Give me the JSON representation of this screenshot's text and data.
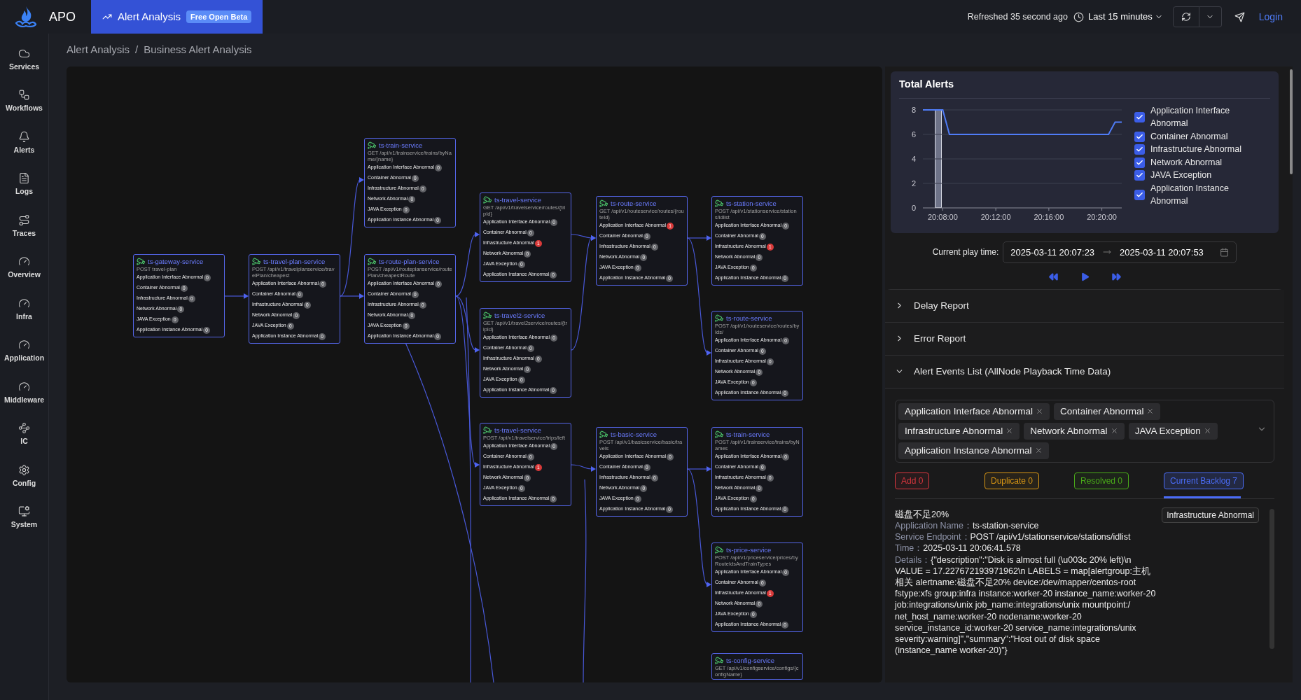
{
  "top_bar": {
    "app_name": "APO",
    "active_tab": {
      "label": "Alert Analysis",
      "badge": "Free Open Beta"
    },
    "refreshed": "Refreshed 35 second ago",
    "time_range": "Last 15 minutes",
    "login": "Login"
  },
  "sidebar": {
    "items": [
      {
        "label": "Services"
      },
      {
        "label": "Workflows"
      },
      {
        "label": "Alerts"
      },
      {
        "label": "Logs"
      },
      {
        "label": "Traces"
      },
      {
        "label": "Overview"
      },
      {
        "label": "Infra"
      },
      {
        "label": "Application"
      },
      {
        "label": "Middleware"
      },
      {
        "label": "IC"
      },
      {
        "label": "Config"
      },
      {
        "label": "System"
      }
    ]
  },
  "breadcrumb": {
    "items": [
      "Alert Analysis",
      "Business Alert Analysis"
    ],
    "separator": "/"
  },
  "graph": {
    "nodes": [
      {
        "name": "ts-gateway-service",
        "endpoint": "POST travel-plan",
        "rows": [
          {
            "label": "Application Interface Abnormal",
            "count": "0",
            "alert": false
          },
          {
            "label": "Container Abnormal",
            "count": "0",
            "alert": false
          },
          {
            "label": "Infrastructure Abnormal",
            "count": "0",
            "alert": false
          },
          {
            "label": "Network Abnormal",
            "count": "0",
            "alert": false
          },
          {
            "label": "JAVA Exception",
            "count": "0",
            "alert": false
          },
          {
            "label": "Application Instance Abnormal",
            "count": "0",
            "alert": false
          }
        ]
      },
      {
        "name": "ts-travel-plan-service",
        "endpoint": "POST /api/v1/travelplanservice/travelPlan/cheapest",
        "rows": [
          {
            "label": "Application Interface Abnormal",
            "count": "0",
            "alert": false
          },
          {
            "label": "Container Abnormal",
            "count": "0",
            "alert": false
          },
          {
            "label": "Infrastructure Abnormal",
            "count": "0",
            "alert": false
          },
          {
            "label": "Network Abnormal",
            "count": "0",
            "alert": false
          },
          {
            "label": "JAVA Exception",
            "count": "0",
            "alert": false
          },
          {
            "label": "Application Instance Abnormal",
            "count": "0",
            "alert": false
          }
        ]
      },
      {
        "name": "ts-train-service",
        "endpoint": "GET /api/v1/trainservice/trains/byName/{name}",
        "rows": [
          {
            "label": "Application Interface Abnormal",
            "count": "0",
            "alert": false
          },
          {
            "label": "Container Abnormal",
            "count": "0",
            "alert": false
          },
          {
            "label": "Infrastructure Abnormal",
            "count": "0",
            "alert": false
          },
          {
            "label": "Network Abnormal",
            "count": "0",
            "alert": false
          },
          {
            "label": "JAVA Exception",
            "count": "0",
            "alert": false
          },
          {
            "label": "Application Instance Abnormal",
            "count": "0",
            "alert": false
          }
        ]
      },
      {
        "name": "ts-route-plan-service",
        "endpoint": "POST /api/v1/routeplanservice/routePlan/cheapestRoute",
        "rows": [
          {
            "label": "Application Interface Abnormal",
            "count": "0",
            "alert": false
          },
          {
            "label": "Container Abnormal",
            "count": "0",
            "alert": false
          },
          {
            "label": "Infrastructure Abnormal",
            "count": "0",
            "alert": false
          },
          {
            "label": "Network Abnormal",
            "count": "0",
            "alert": false
          },
          {
            "label": "JAVA Exception",
            "count": "0",
            "alert": false
          },
          {
            "label": "Application Instance Abnormal",
            "count": "0",
            "alert": false
          }
        ]
      },
      {
        "name": "ts-travel-service",
        "endpoint": "GET /api/v1/travelservice/routes/{tripId}",
        "rows": [
          {
            "label": "Application Interface Abnormal",
            "count": "0",
            "alert": false
          },
          {
            "label": "Container Abnormal",
            "count": "0",
            "alert": false
          },
          {
            "label": "Infrastructure Abnormal",
            "count": "1",
            "alert": true
          },
          {
            "label": "Network Abnormal",
            "count": "0",
            "alert": false
          },
          {
            "label": "JAVA Exception",
            "count": "0",
            "alert": false
          },
          {
            "label": "Application Instance Abnormal",
            "count": "0",
            "alert": false
          }
        ]
      },
      {
        "name": "ts-travel2-service",
        "endpoint": "GET /api/v1/travel2service/routes/{tripId}",
        "rows": [
          {
            "label": "Application Interface Abnormal",
            "count": "0",
            "alert": false
          },
          {
            "label": "Container Abnormal",
            "count": "0",
            "alert": false
          },
          {
            "label": "Infrastructure Abnormal",
            "count": "0",
            "alert": false
          },
          {
            "label": "Network Abnormal",
            "count": "0",
            "alert": false
          },
          {
            "label": "JAVA Exception",
            "count": "0",
            "alert": false
          },
          {
            "label": "Application Instance Abnormal",
            "count": "0",
            "alert": false
          }
        ]
      },
      {
        "name": "ts-travel-service",
        "endpoint": "POST /api/v1/travelservice/trips/left",
        "rows": [
          {
            "label": "Application Interface Abnormal",
            "count": "0",
            "alert": false
          },
          {
            "label": "Container Abnormal",
            "count": "0",
            "alert": false
          },
          {
            "label": "Infrastructure Abnormal",
            "count": "1",
            "alert": true
          },
          {
            "label": "Network Abnormal",
            "count": "0",
            "alert": false
          },
          {
            "label": "JAVA Exception",
            "count": "0",
            "alert": false
          },
          {
            "label": "Application Instance Abnormal",
            "count": "0",
            "alert": false
          }
        ]
      },
      {
        "name": "ts-route-service",
        "endpoint": "GET /api/v1/routeservice/routes/{routeId}",
        "rows": [
          {
            "label": "Application Interface Abnormal",
            "count": "1",
            "alert": true
          },
          {
            "label": "Container Abnormal",
            "count": "0",
            "alert": false
          },
          {
            "label": "Infrastructure Abnormal",
            "count": "0",
            "alert": false
          },
          {
            "label": "Network Abnormal",
            "count": "0",
            "alert": false
          },
          {
            "label": "JAVA Exception",
            "count": "0",
            "alert": false
          },
          {
            "label": "Application Instance Abnormal",
            "count": "0",
            "alert": false
          }
        ]
      },
      {
        "name": "ts-basic-service",
        "endpoint": "POST /api/v1/basicservice/basic/travels",
        "rows": [
          {
            "label": "Application Interface Abnormal",
            "count": "0",
            "alert": false
          },
          {
            "label": "Container Abnormal",
            "count": "0",
            "alert": false
          },
          {
            "label": "Infrastructure Abnormal",
            "count": "0",
            "alert": false
          },
          {
            "label": "Network Abnormal",
            "count": "0",
            "alert": false
          },
          {
            "label": "JAVA Exception",
            "count": "0",
            "alert": false
          },
          {
            "label": "Application Instance Abnormal",
            "count": "0",
            "alert": false
          }
        ]
      },
      {
        "name": "ts-station-service",
        "endpoint": "POST /api/v1/stationservice/stations/idlist",
        "rows": [
          {
            "label": "Application Interface Abnormal",
            "count": "0",
            "alert": false
          },
          {
            "label": "Container Abnormal",
            "count": "0",
            "alert": false
          },
          {
            "label": "Infrastructure Abnormal",
            "count": "1",
            "alert": true
          },
          {
            "label": "Network Abnormal",
            "count": "0",
            "alert": false
          },
          {
            "label": "JAVA Exception",
            "count": "0",
            "alert": false
          },
          {
            "label": "Application Instance Abnormal",
            "count": "0",
            "alert": false
          }
        ]
      },
      {
        "name": "ts-route-service",
        "endpoint": "POST /api/v1/routeservice/routes/byIds/",
        "rows": [
          {
            "label": "Application Interface Abnormal",
            "count": "0",
            "alert": false
          },
          {
            "label": "Container Abnormal",
            "count": "0",
            "alert": false
          },
          {
            "label": "Infrastructure Abnormal",
            "count": "0",
            "alert": false
          },
          {
            "label": "Network Abnormal",
            "count": "0",
            "alert": false
          },
          {
            "label": "JAVA Exception",
            "count": "0",
            "alert": false
          },
          {
            "label": "Application Instance Abnormal",
            "count": "0",
            "alert": false
          }
        ]
      },
      {
        "name": "ts-train-service",
        "endpoint": "POST /api/v1/trainservice/trains/byNames",
        "rows": [
          {
            "label": "Application Interface Abnormal",
            "count": "0",
            "alert": false
          },
          {
            "label": "Container Abnormal",
            "count": "0",
            "alert": false
          },
          {
            "label": "Infrastructure Abnormal",
            "count": "0",
            "alert": false
          },
          {
            "label": "Network Abnormal",
            "count": "0",
            "alert": false
          },
          {
            "label": "JAVA Exception",
            "count": "0",
            "alert": false
          },
          {
            "label": "Application Instance Abnormal",
            "count": "0",
            "alert": false
          }
        ]
      },
      {
        "name": "ts-price-service",
        "endpoint": "POST /api/v1/priceservice/prices/byRouteIdsAndTrainTypes",
        "rows": [
          {
            "label": "Application Interface Abnormal",
            "count": "0",
            "alert": false
          },
          {
            "label": "Container Abnormal",
            "count": "0",
            "alert": false
          },
          {
            "label": "Infrastructure Abnormal",
            "count": "1",
            "alert": true
          },
          {
            "label": "Network Abnormal",
            "count": "0",
            "alert": false
          },
          {
            "label": "JAVA Exception",
            "count": "0",
            "alert": false
          },
          {
            "label": "Application Instance Abnormal",
            "count": "0",
            "alert": false
          }
        ]
      },
      {
        "name": "ts-config-service",
        "endpoint": "GET /api/v1/configservice/configs/{configName}"
      }
    ]
  },
  "total_alerts": {
    "chart_data": {
      "type": "line",
      "title": "Total Alerts",
      "categories": [
        null,
        null,
        null,
        "20:08:00",
        null,
        null,
        null,
        null,
        null,
        null,
        null,
        "20:12:00",
        null,
        null,
        null,
        null,
        null,
        null,
        null,
        "20:16:00",
        null,
        null,
        null,
        null,
        null,
        null,
        null,
        "20:20:00",
        null,
        null,
        null
      ],
      "values": [
        8,
        8,
        8,
        8,
        6,
        6,
        6,
        6,
        6,
        6,
        6,
        6,
        6,
        6,
        6,
        6,
        6,
        6,
        6,
        6,
        6,
        6,
        6,
        6,
        6,
        6,
        6,
        6,
        6,
        7,
        7
      ],
      "ylim": [
        0,
        8
      ],
      "yticks": [
        0,
        2,
        4,
        6,
        8
      ],
      "grid": true
    },
    "legend": [
      {
        "label": "Application Interface Abnormal",
        "checked": true
      },
      {
        "label": "Container Abnormal",
        "checked": true
      },
      {
        "label": "Infrastructure Abnormal",
        "checked": true
      },
      {
        "label": "Network Abnormal",
        "checked": true
      },
      {
        "label": "JAVA Exception",
        "checked": true
      },
      {
        "label": "Application Instance Abnormal",
        "checked": true
      }
    ]
  },
  "playback": {
    "label": "Current play time:",
    "start": "2025-03-11 20:07:23",
    "end": "2025-03-11 20:07:53"
  },
  "sections": [
    {
      "title": "Delay Report",
      "expanded": false
    },
    {
      "title": "Error Report",
      "expanded": false
    },
    {
      "title": "Alert Events List (AllNode Playback Time Data)",
      "expanded": true
    }
  ],
  "alert_filter": {
    "tags": [
      "Application Interface Abnormal",
      "Container Abnormal",
      "Infrastructure Abnormal",
      "Network Abnormal",
      "JAVA Exception",
      "Application Instance Abnormal"
    ]
  },
  "event_tabs": [
    {
      "label": "Add 0",
      "color": "#d9363e",
      "selected": false
    },
    {
      "label": "Duplicate 0",
      "color": "#d89614",
      "selected": false
    },
    {
      "label": "Resolved 0",
      "color": "#49aa19",
      "selected": false
    },
    {
      "label": "Current Backlog 7",
      "color": "#4a6cf7",
      "selected": true
    }
  ],
  "events": [
    {
      "title": "磁盘不足20%",
      "type": "Infrastructure Abnormal",
      "fields": [
        {
          "label": "Application Name：",
          "value": "ts-station-service"
        },
        {
          "label": "Service Endpoint：",
          "value": "POST /api/v1/stationservice/stations/idlist"
        },
        {
          "label": "Time：",
          "value": "2025-03-11 20:06:41.578"
        },
        {
          "label": "Details：",
          "value": "{\"description\":\"Disk is almost full (\\u003c 20% left)\\n VALUE = 17.227672193971962\\n LABELS = map[alertgroup:主机相关 alertname:磁盘不足20% device:/dev/mapper/centos-root fstype:xfs group:infra instance:worker-20 instance_name:worker-20 job:integrations/unix job_name:integrations/unix mountpoint:/ net_host_name:worker-20 nodename:worker-20 service_instance_id:worker-20 service_name:integrations/unix severity:warning]\",\"summary\":\"Host out of disk space (instance_name worker-20)\"}"
        }
      ]
    }
  ]
}
